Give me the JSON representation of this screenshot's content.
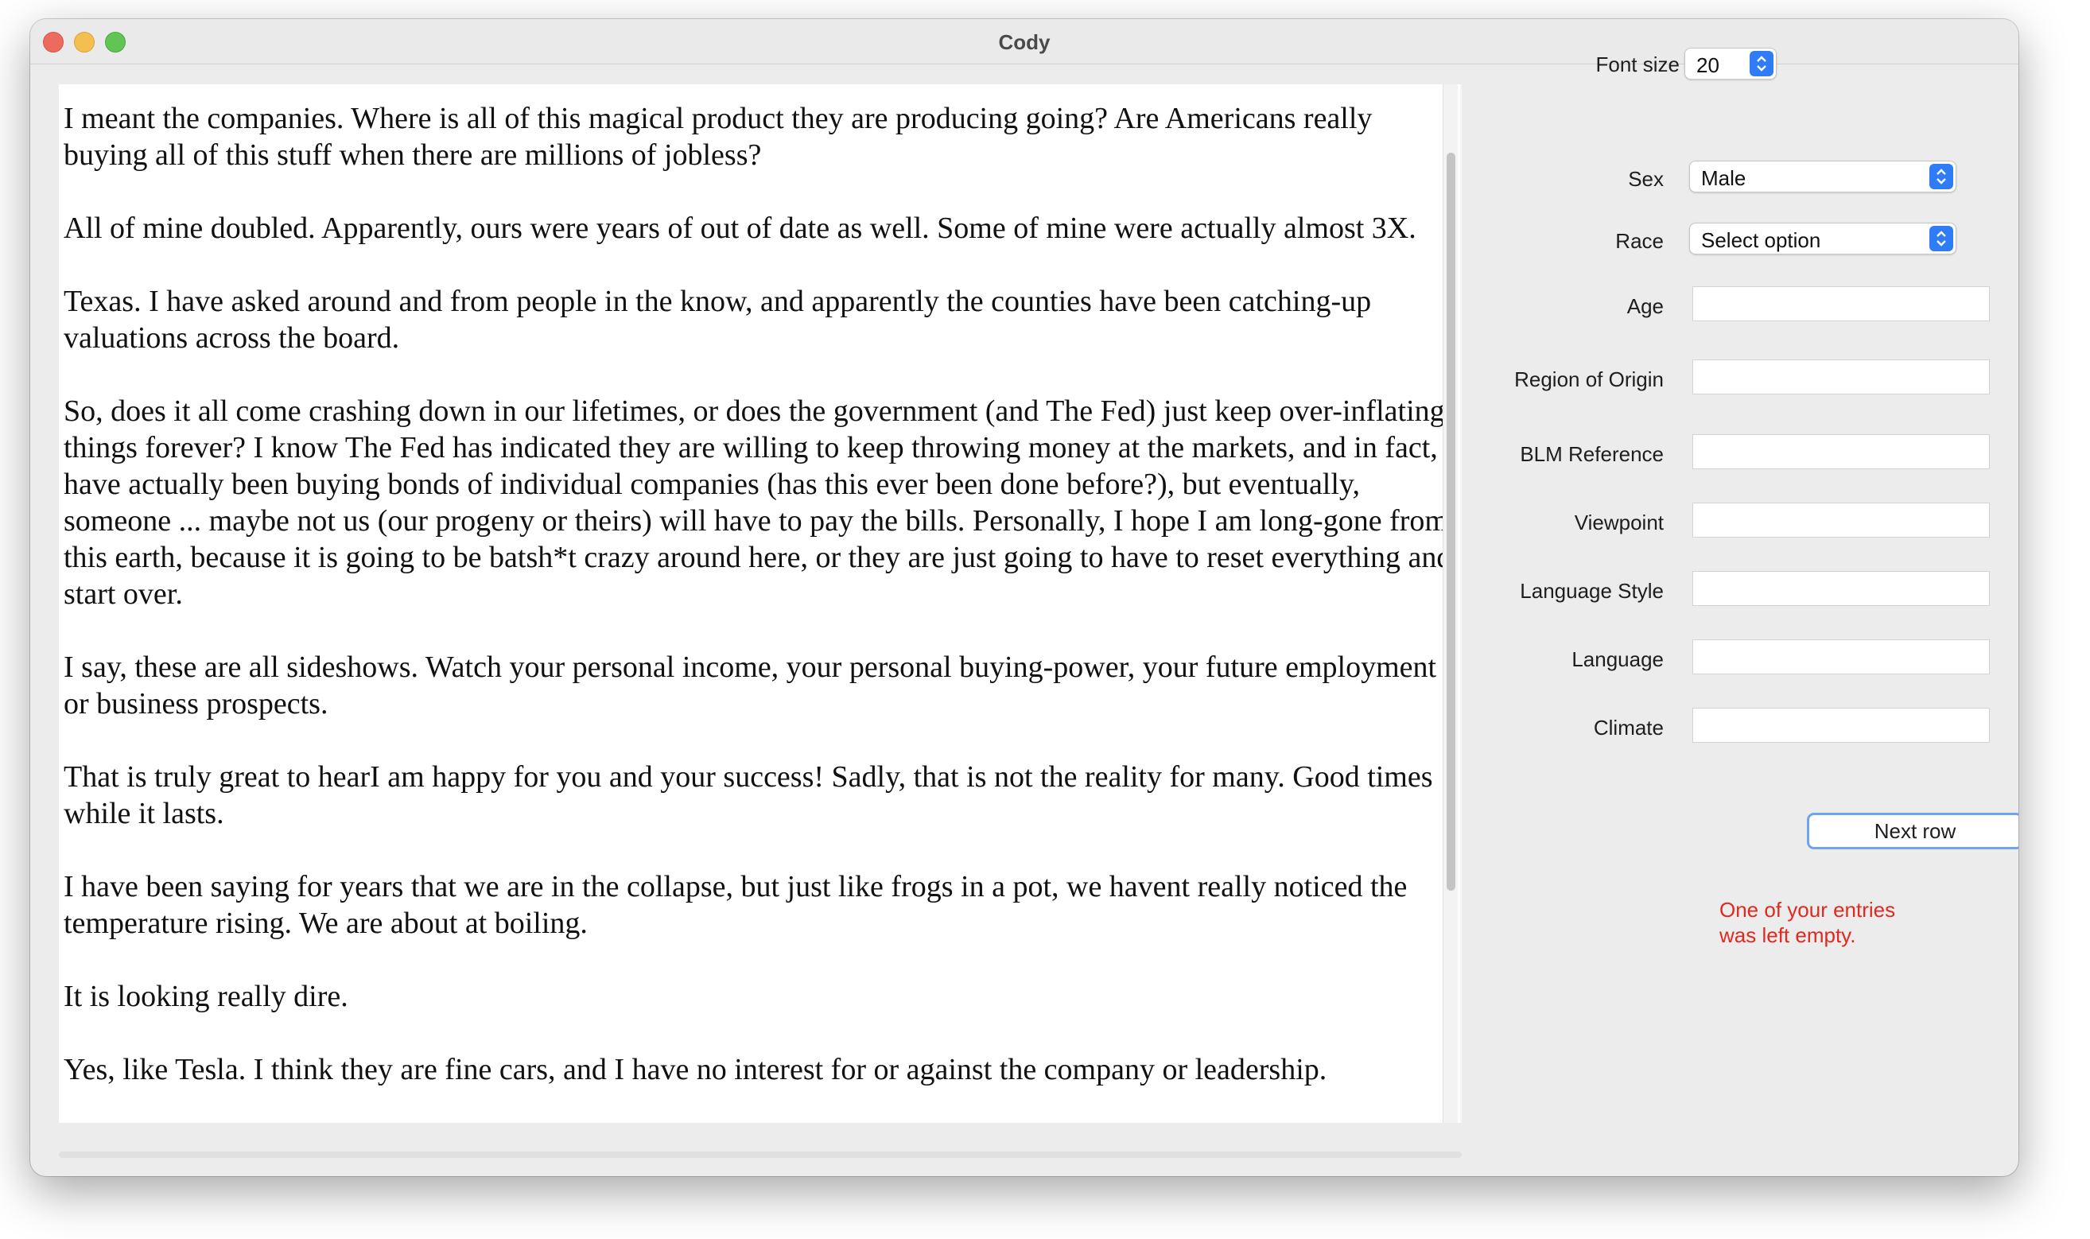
{
  "window": {
    "title": "Cody"
  },
  "text_pane": {
    "paragraphs": [
      "I meant the companies. Where is all of this magical product they are producing going? Are Americans really buying all of this stuff when there are millions of jobless?",
      "All of mine doubled. Apparently, ours were years of out of date as well. Some of mine were actually almost 3X.",
      "Texas. I have asked around and from people in the know, and apparently the counties have been catching-up valuations across the board.",
      "So, does it all come crashing down in our lifetimes, or does the government (and The Fed) just keep over-inflating things forever? I know The Fed has indicated they are willing to keep throwing money at the markets, and in fact, have actually been buying bonds of individual companies (has this ever been done before?), but eventually, someone ... maybe not us (our progeny or theirs) will have to pay the bills. Personally, I hope I am long-gone from this earth, because it is going to be batsh*t crazy around here, or they are just going to have to reset everything and start over.",
      "I say, these are all sideshows. Watch your personal income, your personal buying-power, your future employment or business prospects.",
      "That is truly great to hearI am happy for you and your success! Sadly, that is not the reality for many. Good times while it lasts.",
      "I have been saying for years that we are in the collapse, but just like frogs in a pot, we havent really noticed the temperature rising. We are about at boiling.",
      "It is looking really dire.",
      "Yes, like Tesla. I think they are fine cars, and I have no interest for or against the company or leadership."
    ]
  },
  "form": {
    "font_size": {
      "label": "Font size",
      "value": "20"
    },
    "sex": {
      "label": "Sex",
      "value": "Male"
    },
    "race": {
      "label": "Race",
      "value": "Select option"
    },
    "age": {
      "label": "Age",
      "value": ""
    },
    "region": {
      "label": "Region of Origin",
      "value": ""
    },
    "blm": {
      "label": "BLM Reference",
      "value": ""
    },
    "viewpoint": {
      "label": "Viewpoint",
      "value": ""
    },
    "language_style": {
      "label": "Language Style",
      "value": ""
    },
    "language": {
      "label": "Language",
      "value": ""
    },
    "climate": {
      "label": "Climate",
      "value": ""
    },
    "next_button": "Next row",
    "error_line1": "One of your entries",
    "error_line2": "was left empty."
  },
  "colors": {
    "accent": "#2f7cf6",
    "error": "#e0291f",
    "close": "#ed6a5e",
    "minimize": "#f5bf4f",
    "maximize": "#61c554"
  },
  "icons": {
    "stepper": "chevron-up-down-icon"
  }
}
